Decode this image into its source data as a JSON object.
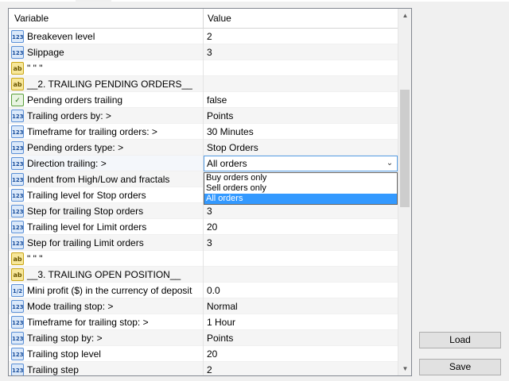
{
  "header": {
    "variable": "Variable",
    "value": "Value"
  },
  "rows": [
    {
      "icon": "123",
      "type": "num",
      "name": "Breakeven level",
      "value": "2"
    },
    {
      "icon": "123",
      "type": "num",
      "name": "Slippage",
      "value": "3"
    },
    {
      "icon": "ab",
      "type": "str",
      "name": "\" \" \"",
      "value": ""
    },
    {
      "icon": "ab",
      "type": "str",
      "name": "__2. TRAILING PENDING ORDERS__",
      "value": ""
    },
    {
      "icon": "✓",
      "type": "bool",
      "name": "Pending orders trailing",
      "value": "false"
    },
    {
      "icon": "123",
      "type": "num",
      "name": "Trailing orders by: >",
      "value": "Points"
    },
    {
      "icon": "123",
      "type": "num",
      "name": "Timeframe for trailing orders: >",
      "value": "30 Minutes"
    },
    {
      "icon": "123",
      "type": "num",
      "name": "Pending orders type: >",
      "value": "Stop Orders"
    },
    {
      "icon": "123",
      "type": "num",
      "name": "Direction trailing: >",
      "value": "All orders"
    },
    {
      "icon": "123",
      "type": "num",
      "name": "Indent from High/Low and fractals",
      "value": ""
    },
    {
      "icon": "123",
      "type": "num",
      "name": "Trailing level for Stop orders",
      "value": ""
    },
    {
      "icon": "123",
      "type": "num",
      "name": "Step for trailing Stop orders",
      "value": "3"
    },
    {
      "icon": "123",
      "type": "num",
      "name": "Trailing level for Limit orders",
      "value": "20"
    },
    {
      "icon": "123",
      "type": "num",
      "name": "Step for trailing Limit orders",
      "value": "3"
    },
    {
      "icon": "ab",
      "type": "str",
      "name": "\" \" \"",
      "value": ""
    },
    {
      "icon": "ab",
      "type": "str",
      "name": "__3. TRAILING OPEN POSITION__",
      "value": ""
    },
    {
      "icon": "1/2",
      "type": "dbl",
      "name": "Mini profit ($) in the currency of deposit",
      "value": "0.0"
    },
    {
      "icon": "123",
      "type": "num",
      "name": "Mode trailing stop: >",
      "value": "Normal"
    },
    {
      "icon": "123",
      "type": "num",
      "name": "Timeframe for trailing stop: >",
      "value": "1 Hour"
    },
    {
      "icon": "123",
      "type": "num",
      "name": "Trailing stop by: >",
      "value": "Points"
    },
    {
      "icon": "123",
      "type": "num",
      "name": "Trailing stop level",
      "value": "20"
    },
    {
      "icon": "123",
      "type": "num",
      "name": "Trailing step",
      "value": "2"
    }
  ],
  "combo": {
    "value": "All orders",
    "arrow": "⌄"
  },
  "dropdown": {
    "options": [
      "Buy orders only",
      "Sell orders only",
      "All orders"
    ],
    "selected_index": 2
  },
  "scrollbar": {
    "up": "▲",
    "down": "▼"
  },
  "buttons": {
    "load": "Load",
    "save": "Save"
  },
  "colors": {
    "selection": "#3399ff",
    "combo_border": "#569de5"
  }
}
